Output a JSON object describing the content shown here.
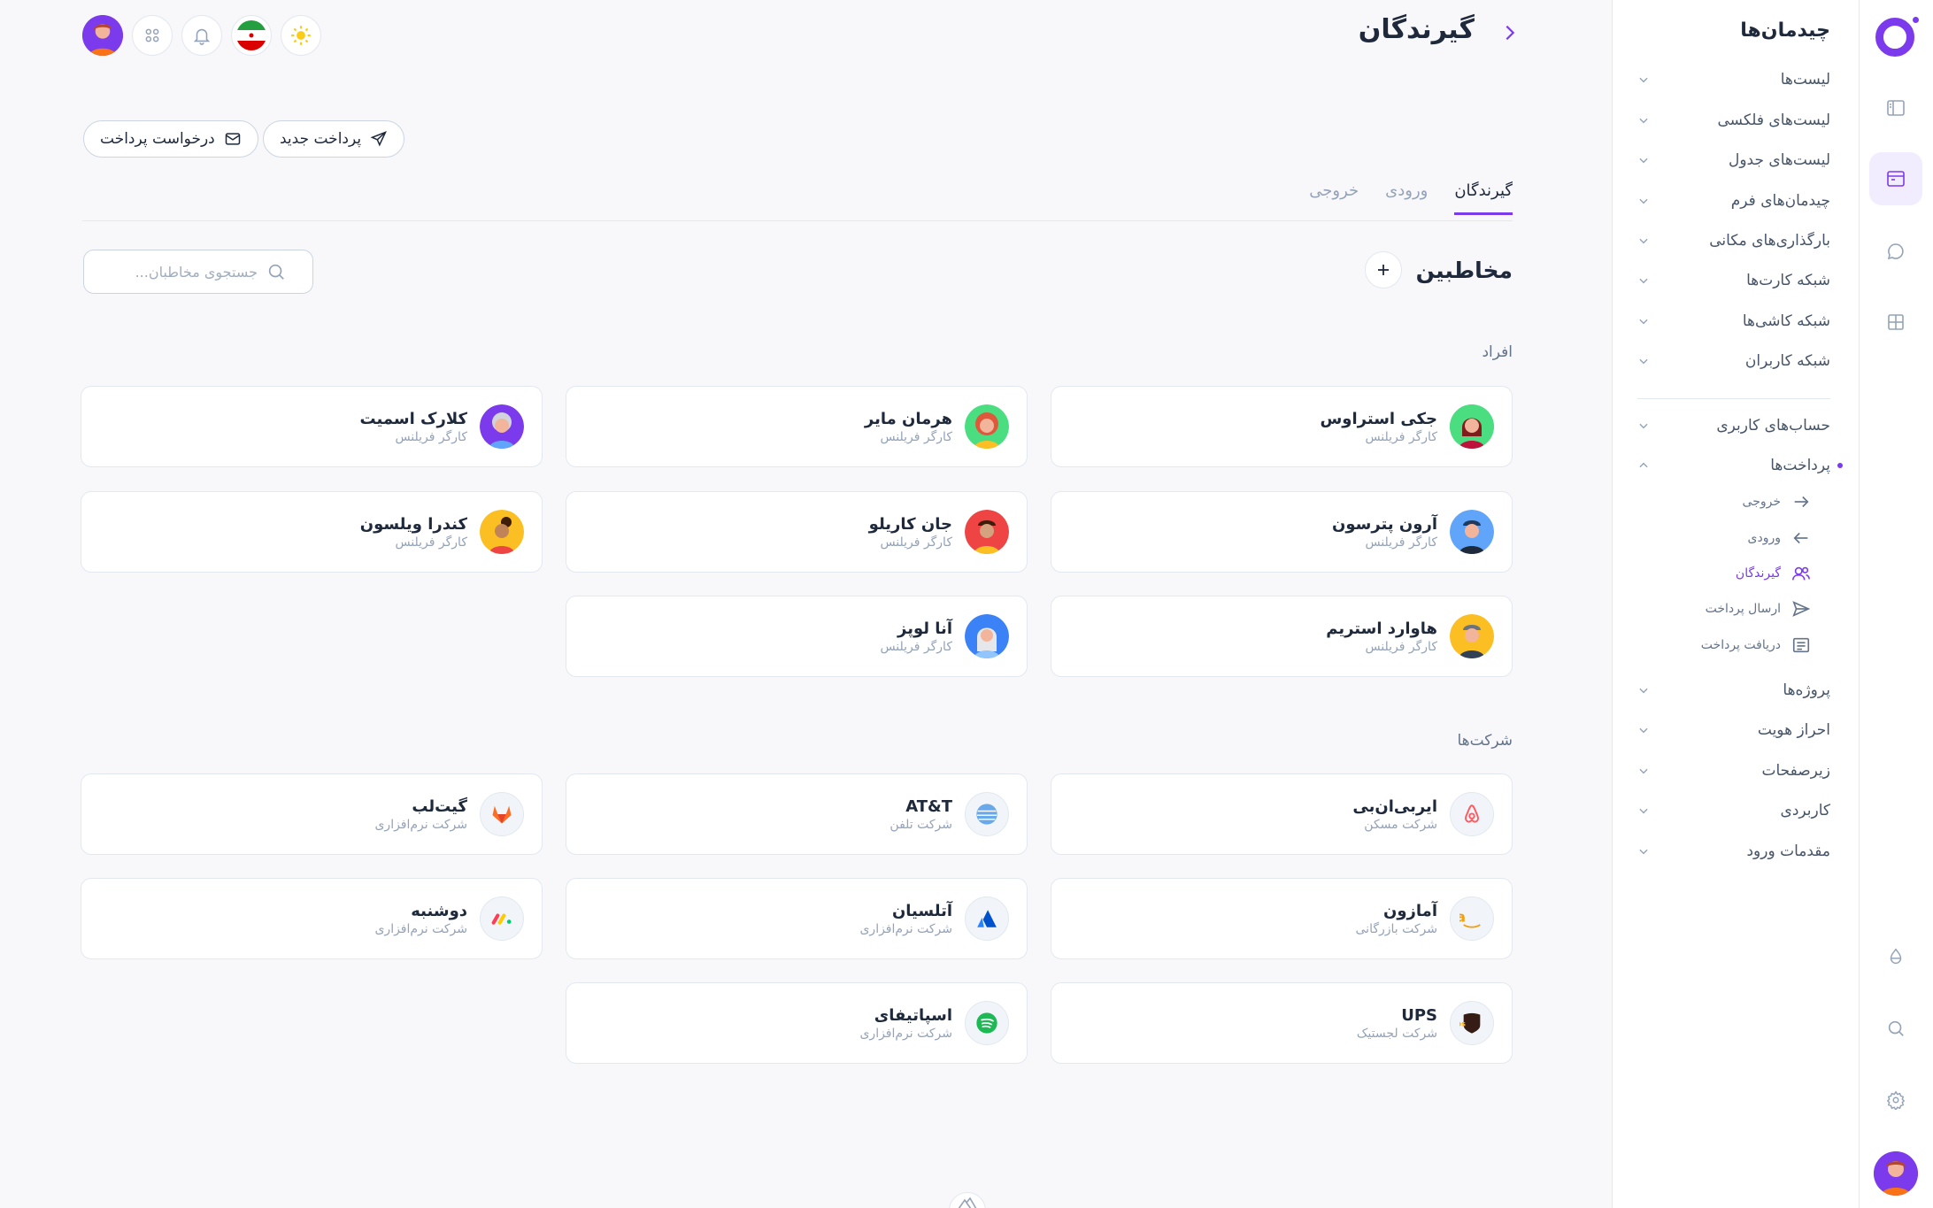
{
  "app": {
    "sidebar_title": "چیدمان‌ها",
    "accent": "#7c3aed"
  },
  "header": {
    "title": "گیرندگان"
  },
  "actions": {
    "new_payment": "پرداخت جدید",
    "request_payment": "درخواست پرداخت"
  },
  "tabs": [
    {
      "label": "گیرندگان",
      "active": true
    },
    {
      "label": "ورودی",
      "active": false
    },
    {
      "label": "خروجی",
      "active": false
    }
  ],
  "contacts": {
    "title": "مخاطبین",
    "search_placeholder": "جستجوی مخاطبان..."
  },
  "people_section": "افراد",
  "companies_section": "شرکت‌ها",
  "people": [
    {
      "name": "جکی استراوس",
      "role": "کارگر فریلنس"
    },
    {
      "name": "هرمان مایر",
      "role": "کارگر فریلنس"
    },
    {
      "name": "کلارک اسمیت",
      "role": "کارگر فریلنس"
    },
    {
      "name": "آرون پترسون",
      "role": "کارگر فریلنس"
    },
    {
      "name": "جان کاریلو",
      "role": "کارگر فریلنس"
    },
    {
      "name": "کندرا ویلسون",
      "role": "کارگر فریلنس"
    },
    {
      "name": "هاوارد استریم",
      "role": "کارگر فریلنس"
    },
    {
      "name": "آنا لوپز",
      "role": "کارگر فریلنس"
    }
  ],
  "companies": [
    {
      "name": "ایربی‌ان‌بی",
      "type": "شرکت مسکن"
    },
    {
      "name": "AT&T",
      "type": "شرکت تلفن"
    },
    {
      "name": "گیت‌لب",
      "type": "شرکت نرم‌افزاری"
    },
    {
      "name": "آمازون",
      "type": "شرکت بازرگانی"
    },
    {
      "name": "آتلسیان",
      "type": "شرکت نرم‌افزاری"
    },
    {
      "name": "دوشنبه",
      "type": "شرکت نرم‌افزاری"
    },
    {
      "name": "UPS",
      "type": "شرکت لجستیک"
    },
    {
      "name": "اسپاتیفای",
      "type": "شرکت نرم‌افزاری"
    }
  ],
  "sidebar": {
    "items": [
      {
        "label": "لیست‌ها"
      },
      {
        "label": "لیست‌های فلکسی"
      },
      {
        "label": "لیست‌های جدول"
      },
      {
        "label": "چیدمان‌های فرم"
      },
      {
        "label": "بارگذاری‌های مکانی"
      },
      {
        "label": "شبکه کارت‌ها"
      },
      {
        "label": "شبکه کاشی‌ها"
      },
      {
        "label": "شبکه کاربران"
      },
      {
        "label": "حساب‌های کاربری"
      },
      {
        "label": "پرداخت‌ها"
      },
      {
        "label": "پروژه‌ها"
      },
      {
        "label": "احراز هویت"
      },
      {
        "label": "زیرصفحات"
      },
      {
        "label": "کاربردی"
      },
      {
        "label": "مقدمات ورود"
      }
    ],
    "payments_sub": [
      {
        "label": "خروجی"
      },
      {
        "label": "ورودی"
      },
      {
        "label": "گیرندگان"
      },
      {
        "label": "ارسال پرداخت"
      },
      {
        "label": "دریافت پرداخت"
      }
    ]
  }
}
